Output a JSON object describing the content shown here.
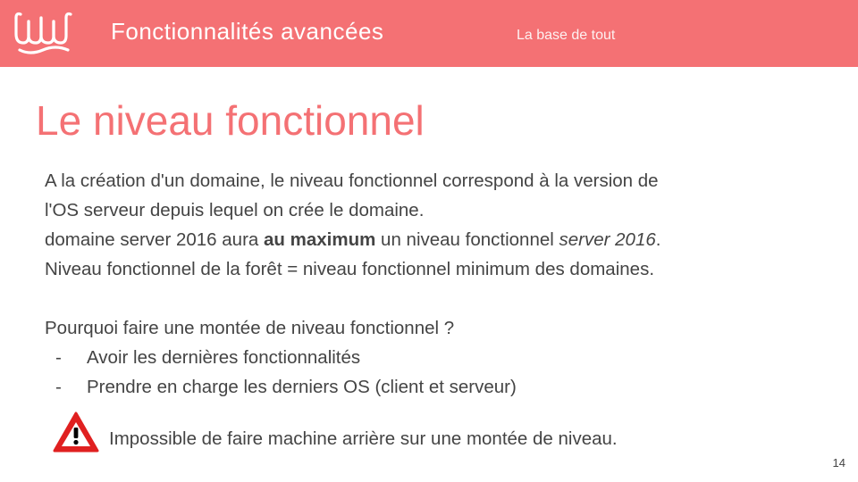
{
  "header": {
    "title": "Fonctionnalités avancées",
    "subtitle": "La base de tout",
    "logo_icon": "wave-logo-icon"
  },
  "slide": {
    "title": "Le niveau fonctionnel",
    "line1": "A la création d'un domaine, le niveau fonctionnel correspond à la version de",
    "line2": "l'OS serveur depuis lequel on crée le domaine.",
    "line3_prefix": "domaine server 2016 aura ",
    "line3_bold": "au maximum",
    "line3_middle": " un niveau fonctionnel ",
    "line3_italic": "server 2016",
    "line3_suffix": ".",
    "line4": "Niveau fonctionnel de la forêt = niveau fonctionnel minimum des domaines.",
    "question": "Pourquoi faire une montée de niveau fonctionnel ?",
    "bullets": [
      {
        "dash": "-",
        "text": "Avoir les dernières fonctionnalités"
      },
      {
        "dash": "-",
        "text": "Prendre en charge les derniers OS (client et serveur)"
      }
    ],
    "warning_icon": "warning-triangle-icon",
    "warning_text": "Impossible de faire machine arrière sur une montée de niveau."
  },
  "page_number": "14",
  "colors": {
    "accent": "#f47174",
    "text": "#444444",
    "warning_red": "#e02020"
  }
}
